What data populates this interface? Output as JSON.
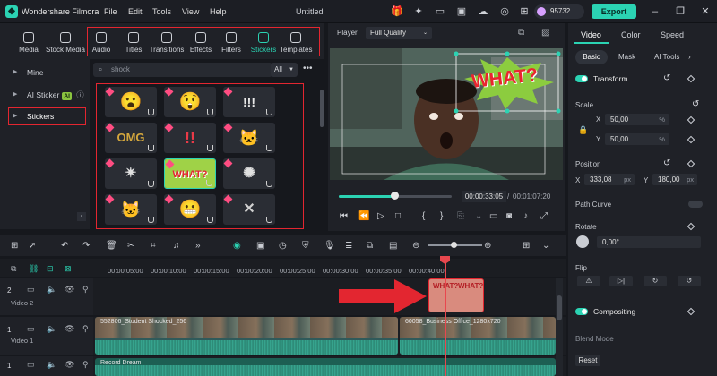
{
  "app": {
    "name": "Wondershare Filmora",
    "doc_title": "Untitled"
  },
  "menu": [
    "File",
    "Edit",
    "Tools",
    "View",
    "Help"
  ],
  "topbar": {
    "credits": "95732",
    "export_label": "Export"
  },
  "media_tabs": [
    {
      "label": "Media",
      "icon": "media-icon"
    },
    {
      "label": "Stock Media",
      "icon": "stock-media-icon"
    },
    {
      "label": "Audio",
      "icon": "music-note-icon"
    },
    {
      "label": "Titles",
      "icon": "text-t-icon"
    },
    {
      "label": "Transitions",
      "icon": "transitions-icon"
    },
    {
      "label": "Effects",
      "icon": "effects-sparkle-icon"
    },
    {
      "label": "Filters",
      "icon": "filters-icon"
    },
    {
      "label": "Stickers",
      "icon": "stickers-icon",
      "active": true
    },
    {
      "label": "Templates",
      "icon": "templates-icon"
    }
  ],
  "sidebar": {
    "items": [
      {
        "label": "Mine"
      },
      {
        "label": "AI Sticker",
        "badge": "AI"
      },
      {
        "label": "Stickers",
        "selected": true
      }
    ]
  },
  "search": {
    "value": "shock"
  },
  "filter": {
    "value": "All"
  },
  "stickers": [
    {
      "kind": "shocked-face-emoji",
      "glyph": "😮"
    },
    {
      "kind": "surprised-face-emoji",
      "glyph": "😲"
    },
    {
      "kind": "exclamation-marks",
      "glyph": "!!!"
    },
    {
      "kind": "omg-text",
      "glyph": "OMG"
    },
    {
      "kind": "red-exclamation",
      "glyph": "!!"
    },
    {
      "kind": "shocked-cat",
      "glyph": "🐱"
    },
    {
      "kind": "burst-lines",
      "glyph": "✴"
    },
    {
      "kind": "what-text",
      "glyph": "WHAT?",
      "selected": true
    },
    {
      "kind": "speed-lines",
      "glyph": "✺"
    },
    {
      "kind": "shocked-cat-2",
      "glyph": "🐱"
    },
    {
      "kind": "grimace-emoji",
      "glyph": "😬"
    },
    {
      "kind": "cracked-glass",
      "glyph": "✕"
    }
  ],
  "player": {
    "label": "Player",
    "quality": "Full Quality",
    "sticker_text": "WHAT?",
    "current_time": "00:00:33:05",
    "total_time": "00:01:07:20",
    "progress": 0.49
  },
  "properties": {
    "tabs": [
      "Video",
      "Color",
      "Speed"
    ],
    "subtabs": [
      "Basic",
      "Mask",
      "AI Tools"
    ],
    "transform_label": "Transform",
    "scale_label": "Scale",
    "scale_x": "50,00",
    "scale_y": "50,00",
    "scale_unit": "%",
    "position_label": "Position",
    "pos_x": "333,08",
    "pos_y": "180,00",
    "pos_unit": "px",
    "path_curve_label": "Path Curve",
    "rotate_label": "Rotate",
    "rotate_value": "0,00°",
    "flip_label": "Flip",
    "compositing_label": "Compositing",
    "blend_label": "Blend Mode",
    "reset_label": "Reset",
    "x": "X",
    "y": "Y"
  },
  "timeline": {
    "ruler": [
      "00:00:05:00",
      "00:00:10:00",
      "00:00:15:00",
      "00:00:20:00",
      "00:00:25:00",
      "00:00:30:00",
      "00:00:35:00",
      "00:00:40:00"
    ],
    "tracks": [
      {
        "label": "Video 2",
        "num": "2"
      },
      {
        "label": "Video 1",
        "num": "1"
      },
      {
        "label": "",
        "num": "1"
      }
    ],
    "clip1_label": "552806_Student Shocked_256",
    "clip2_label": "60058_Business Office_1280x720",
    "audio_label": "Record Dream"
  },
  "colors": {
    "accent": "#2bd3b3",
    "highlight": "#e32630",
    "panel": "#1f2127"
  }
}
